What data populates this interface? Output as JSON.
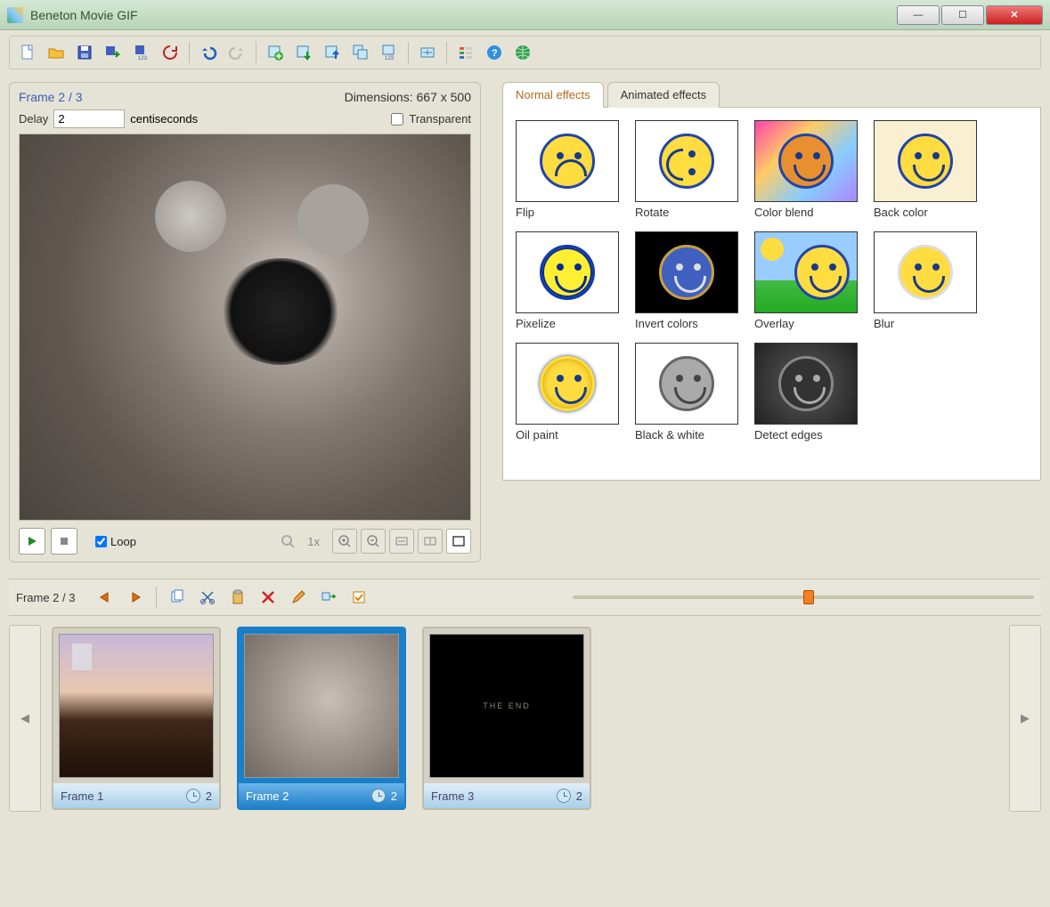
{
  "window": {
    "title": "Beneton Movie GIF"
  },
  "preview": {
    "frame_label": "Frame 2 / 3",
    "dimensions": "Dimensions: 667 x 500",
    "delay_label": "Delay",
    "delay_value": "2",
    "delay_unit": "centiseconds",
    "transparent_label": "Transparent",
    "transparent_checked": false,
    "loop_label": "Loop",
    "loop_checked": true,
    "zoom_label": "1x"
  },
  "effects": {
    "tabs": [
      "Normal effects",
      "Animated effects"
    ],
    "active_tab": 0,
    "items": [
      {
        "label": "Flip"
      },
      {
        "label": "Rotate"
      },
      {
        "label": "Color blend"
      },
      {
        "label": "Back color"
      },
      {
        "label": "Pixelize"
      },
      {
        "label": "Invert colors"
      },
      {
        "label": "Overlay"
      },
      {
        "label": "Blur"
      },
      {
        "label": "Oil paint"
      },
      {
        "label": "Black & white"
      },
      {
        "label": "Detect edges"
      }
    ]
  },
  "timeline": {
    "frame_label": "Frame 2 / 3",
    "slider_pos": 0.5,
    "frames": [
      {
        "name": "Frame 1",
        "delay": "2"
      },
      {
        "name": "Frame 2",
        "delay": "2"
      },
      {
        "name": "Frame 3",
        "delay": "2"
      }
    ],
    "selected": 1,
    "third_text": "THE END"
  }
}
